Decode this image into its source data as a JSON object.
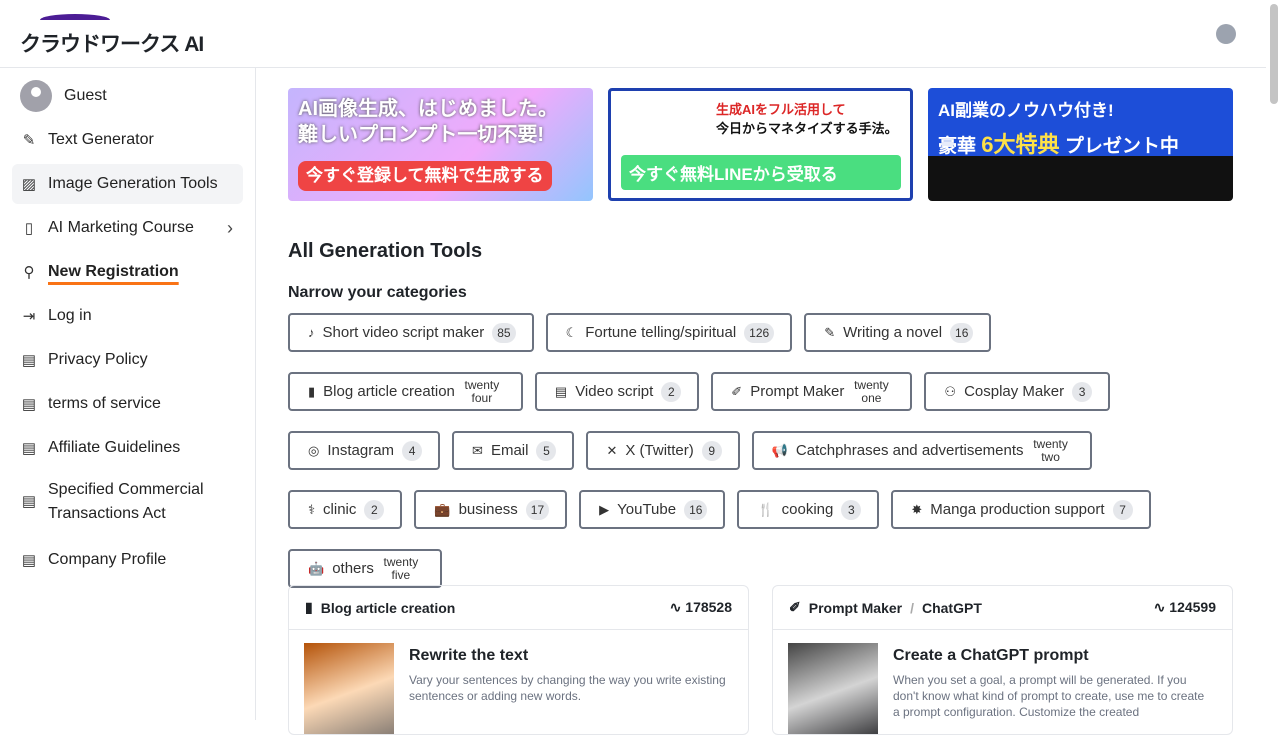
{
  "header": {
    "logo": "クラウドワークス AI",
    "user_icon": "user-circle-icon"
  },
  "sidebar": {
    "user": "Guest",
    "items": [
      {
        "label": "Text Generator",
        "icon": "pencil-icon"
      },
      {
        "label": "Image Generation Tools",
        "icon": "image-icon"
      },
      {
        "label": "AI Marketing Course",
        "icon": "book-icon"
      },
      {
        "label": "New Registration",
        "icon": "user-plus-icon"
      },
      {
        "label": "Log in",
        "icon": "login-icon"
      },
      {
        "label": "Privacy Policy",
        "icon": "document-icon"
      },
      {
        "label": "terms of service",
        "icon": "document-icon"
      },
      {
        "label": "Affiliate Guidelines",
        "icon": "document-icon"
      },
      {
        "label": "Specified Commercial Transactions Act",
        "icon": "document-icon"
      },
      {
        "label": "Company Profile",
        "icon": "document-icon"
      }
    ]
  },
  "banners": [
    {
      "line1": "AI画像生成、はじめました。",
      "line2": "難しいプロンプト一切不要!",
      "cta": "今すぐ登録して無料で生成する"
    },
    {
      "line1": "生成AIをフル活用して",
      "line2": "今日からマネタイズする手法。",
      "cta": "今すぐ無料LINEから受取る"
    },
    {
      "line1": "AI副業のノウハウ付き!",
      "line2": "豪華",
      "line2b": "6大特典",
      "line2c": "プレゼント中"
    }
  ],
  "main": {
    "title": "All Generation Tools",
    "subtitle": "Narrow your categories",
    "categories": [
      {
        "label": "Short video script maker",
        "count": "85",
        "icon": "♪"
      },
      {
        "label": "Fortune telling/spiritual",
        "count": "126",
        "icon": "☾"
      },
      {
        "label": "Writing a novel",
        "count": "16",
        "icon": "✎"
      },
      {
        "label": "Blog article creation",
        "count": "twenty four",
        "icon": "▮"
      },
      {
        "label": "Video script",
        "count": "2",
        "icon": "▤"
      },
      {
        "label": "Prompt Maker",
        "count": "twenty one",
        "icon": "✐"
      },
      {
        "label": "Cosplay Maker",
        "count": "3",
        "icon": "⚇"
      },
      {
        "label": "Instagram",
        "count": "4",
        "icon": "◎"
      },
      {
        "label": "Email",
        "count": "5",
        "icon": "✉"
      },
      {
        "label": "X (Twitter)",
        "count": "9",
        "icon": "✕"
      },
      {
        "label": "Catchphrases and advertisements",
        "count": "twenty two",
        "icon": "📢"
      },
      {
        "label": "clinic",
        "count": "2",
        "icon": "⚕"
      },
      {
        "label": "business",
        "count": "17",
        "icon": "💼"
      },
      {
        "label": "YouTube",
        "count": "16",
        "icon": "▶"
      },
      {
        "label": "cooking",
        "count": "3",
        "icon": "🍴"
      },
      {
        "label": "Manga production support",
        "count": "7",
        "icon": "✸"
      },
      {
        "label": "others",
        "count": "twenty five",
        "icon": "🤖"
      }
    ],
    "cards": [
      {
        "category": "Blog article creation",
        "sub": "",
        "views": "178528",
        "title": "Rewrite the text",
        "description": "Vary your sentences by changing the way you write existing sentences or adding new words."
      },
      {
        "category": "Prompt Maker",
        "sub": "ChatGPT",
        "views": "124599",
        "title": "Create a ChatGPT prompt",
        "description": "When you set a goal, a prompt will be generated. If you don't know what kind of prompt to create, use me to create a prompt configuration. Customize the created"
      }
    ]
  }
}
